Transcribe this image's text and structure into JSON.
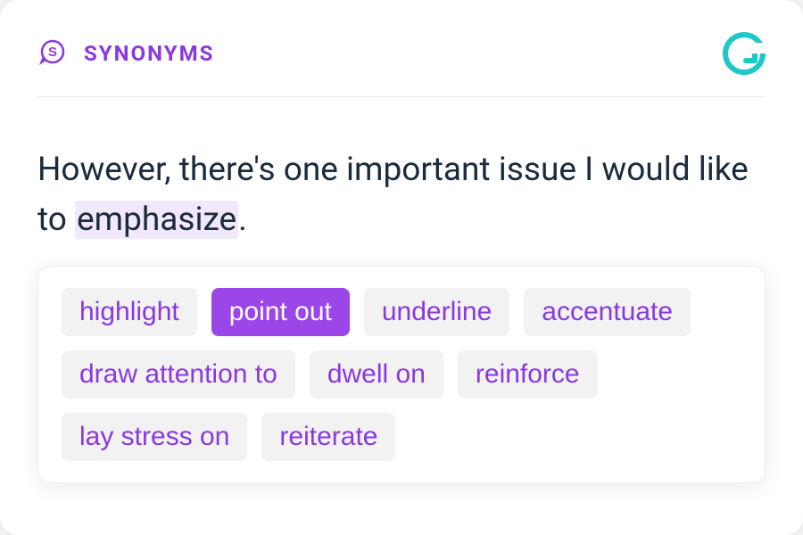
{
  "header": {
    "title": "SYNONYMS",
    "icon_letter": "S"
  },
  "sentence": {
    "before": "However, there's one important issue I would like to ",
    "highlighted": "emphasize",
    "after": "."
  },
  "suggestions": [
    {
      "label": "highlight",
      "selected": false
    },
    {
      "label": "point out",
      "selected": true
    },
    {
      "label": "underline",
      "selected": false
    },
    {
      "label": "accentuate",
      "selected": false
    },
    {
      "label": "draw attention to",
      "selected": false
    },
    {
      "label": "dwell on",
      "selected": false
    },
    {
      "label": "reinforce",
      "selected": false
    },
    {
      "label": "lay stress on",
      "selected": false
    },
    {
      "label": "reiterate",
      "selected": false
    }
  ],
  "colors": {
    "accent": "#8a38e0",
    "accent_bg": "#9a46e8",
    "highlight_bg": "#f1e8fb",
    "chip_bg": "#f2f2f2",
    "logo": "#1ec8c8"
  }
}
